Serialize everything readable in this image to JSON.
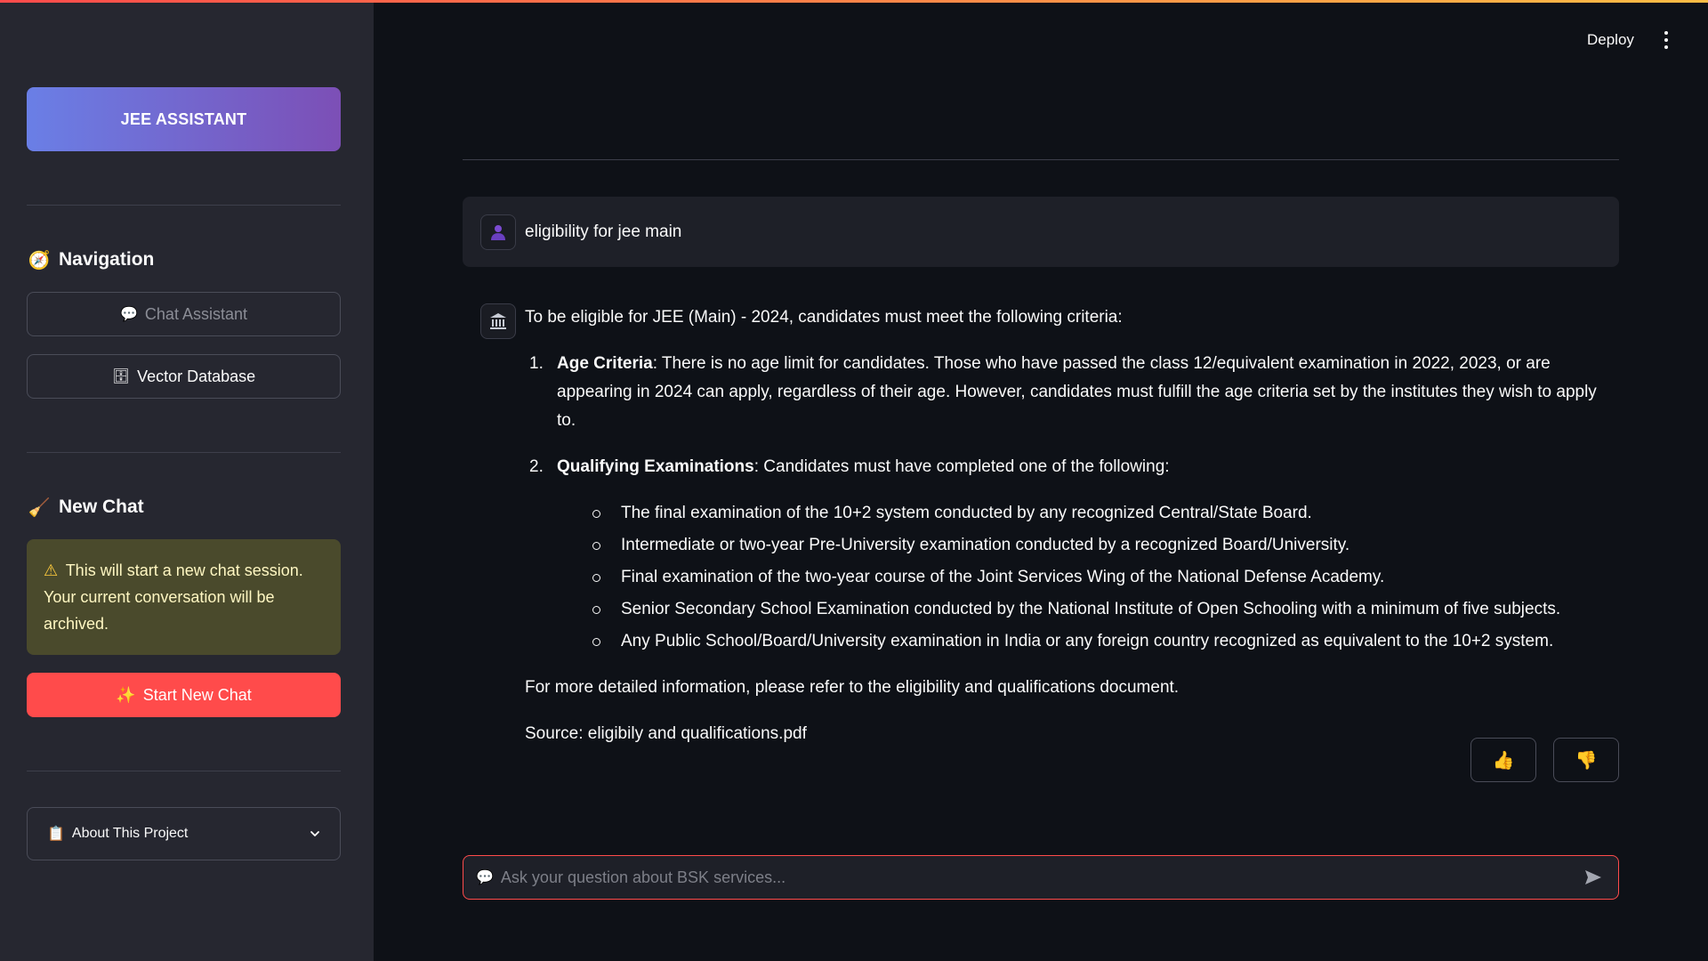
{
  "sidebar": {
    "brand": "JEE ASSISTANT",
    "navigation": {
      "icon": "compass-icon",
      "title": "Navigation"
    },
    "nav_items": [
      {
        "icon": "speech-bubble-icon",
        "label": "Chat Assistant",
        "state": "disabled"
      },
      {
        "icon": "database-icon",
        "label": "Vector Database",
        "state": "enabled"
      }
    ],
    "new_chat": {
      "icon": "broom-icon",
      "title": "New Chat",
      "warning_icon": "warning-icon",
      "warning": "This will start a new chat session. Your current conversation will be archived.",
      "button_icon": "sparkles-icon",
      "button": "Start New Chat"
    },
    "about": {
      "icon": "clipboard-icon",
      "label": "About This Project"
    }
  },
  "header": {
    "deploy": "Deploy"
  },
  "chat": {
    "user_message": "eligibility for jee main",
    "assistant": {
      "intro": "To be eligible for JEE (Main) - 2024, candidates must meet the following criteria:",
      "items": [
        {
          "num": "1.",
          "title": "Age Criteria",
          "text": ": There is no age limit for candidates. Those who have passed the class 12/equivalent examination in 2022, 2023, or are appearing in 2024 can apply, regardless of their age. However, candidates must fulfill the age criteria set by the institutes they wish to apply to."
        },
        {
          "num": "2.",
          "title": "Qualifying Examinations",
          "text": ": Candidates must have completed one of the following:",
          "bullets": [
            "The final examination of the 10+2 system conducted by any recognized Central/State Board.",
            "Intermediate or two-year Pre-University examination conducted by a recognized Board/University.",
            "Final examination of the two-year course of the Joint Services Wing of the National Defense Academy.",
            "Senior Secondary School Examination conducted by the National Institute of Open Schooling with a minimum of five subjects.",
            "Any Public School/Board/University examination in India or any foreign country recognized as equivalent to the 10+2 system."
          ]
        }
      ],
      "closing": "For more detailed information, please refer to the eligibility and qualifications document.",
      "source": "Source: eligibily and qualifications.pdf"
    },
    "feedback": {
      "up_icon": "thumbs-up-icon",
      "down_icon": "thumbs-down-icon"
    }
  },
  "input": {
    "placeholder": "Ask your question about BSK services...",
    "value": ""
  },
  "colors": {
    "primary": "#ff4b4b",
    "sidebar_bg": "#262730",
    "main_bg": "#0e1117",
    "brand_gradient_start": "#6a7fe6",
    "brand_gradient_end": "#7c4fb6",
    "warning_bg": "#4a4a2c"
  }
}
